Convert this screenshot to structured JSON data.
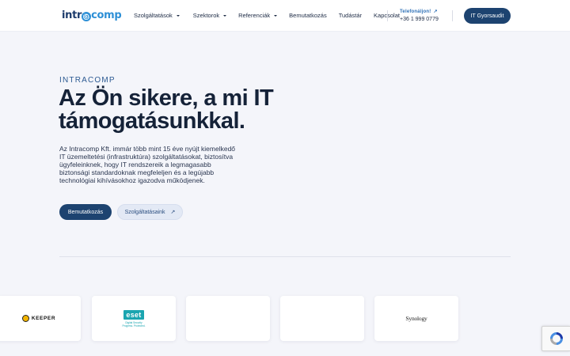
{
  "header": {
    "logo": {
      "part1": "intr",
      "at": "@",
      "part2": "comp"
    },
    "nav": [
      {
        "label": "Szolgáltatások",
        "dropdown": true
      },
      {
        "label": "Szektorok",
        "dropdown": true
      },
      {
        "label": "Referenciák",
        "dropdown": true
      },
      {
        "label": "Bemutatkozás",
        "dropdown": false
      },
      {
        "label": "Tudástár",
        "dropdown": false
      },
      {
        "label": "Kapcsolat",
        "dropdown": false
      }
    ],
    "phone_label": "Telefonáljon!",
    "phone_number": "+36 1 999 0779",
    "cta": "IT Gyorsaudit"
  },
  "hero": {
    "eyebrow": "INTRACOMP",
    "title": "Az Ön sikere, a mi IT támogatásunkkal.",
    "description": "Az Intracomp Kft. immár több mint 15 éve nyújt kiemelkedő IT üzemeltetési (infrastruktúra) szolgáltatásokat, biztosítva ügyfeleinknek, hogy IT rendszereik a legmagasabb biztonsági standardoknak megfeleljen és a legújabb technológiai kihívásokhoz igazodva működjenek.",
    "primary_button": "Bemutatkozás",
    "secondary_button": "Szolgáltatásaink"
  },
  "partners": {
    "keeper": "KEEPER",
    "eset_logo": "eset",
    "eset_sub_line1": "Digital Security",
    "eset_sub_line2": "Progress. Protected.",
    "synology": "Synology"
  },
  "colors": {
    "brand": "#1d4370",
    "accent": "#2c8fd6",
    "background": "#f4f5fa"
  }
}
